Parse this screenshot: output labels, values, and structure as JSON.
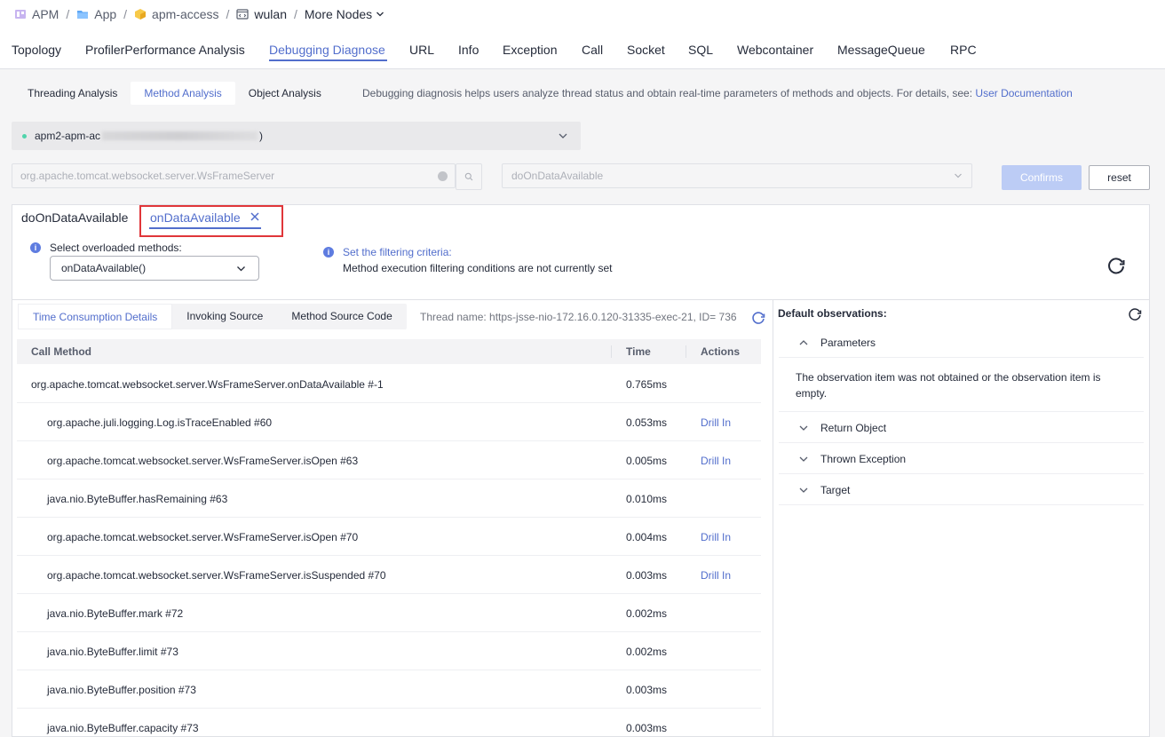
{
  "breadcrumb": {
    "items": [
      {
        "label": "APM",
        "icon": "apm-icon"
      },
      {
        "label": "App",
        "icon": "folder-icon"
      },
      {
        "label": "apm-access",
        "icon": "cube-icon"
      },
      {
        "label": "wulan",
        "icon": "code-window-icon"
      },
      {
        "label": "More Nodes",
        "icon": "chevron-down-icon"
      }
    ]
  },
  "top_tabs": [
    "Topology",
    "ProfilerPerformance Analysis",
    "Debugging Diagnose",
    "URL",
    "Info",
    "Exception",
    "Call",
    "Socket",
    "SQL",
    "Webcontainer",
    "MessageQueue",
    "RPC"
  ],
  "sub_tabs": [
    "Threading Analysis",
    "Method Analysis",
    "Object Analysis"
  ],
  "sub_desc": "Debugging diagnosis helps users analyze thread status and obtain real-time parameters of methods and objects. For details, see:",
  "sub_desc_link": "User Documentation",
  "instance": {
    "prefix": "apm2-apm-ac",
    "suffix": ")"
  },
  "class_input": {
    "value": "org.apache.tomcat.websocket.server.WsFrameServer"
  },
  "method_select": {
    "value": "doOnDataAvailable"
  },
  "buttons": {
    "confirm": "Confirms",
    "reset": "reset"
  },
  "method_tabs": [
    {
      "label": "doOnDataAvailable",
      "active": false
    },
    {
      "label": "onDataAvailable",
      "active": true
    }
  ],
  "overload": {
    "label": "Select overloaded methods:",
    "value": "onDataAvailable()"
  },
  "filter": {
    "link": "Set the filtering criteria:",
    "status": "Method execution filtering conditions are not currently set"
  },
  "inner_tabs": [
    "Time Consumption Details",
    "Invoking Source",
    "Method Source Code"
  ],
  "thread_name": "Thread name: https-jsse-nio-172.16.0.120-31335-exec-21, ID= 736",
  "table": {
    "headers": {
      "method": "Call Method",
      "time": "Time",
      "actions": "Actions"
    },
    "rows": [
      {
        "method": "org.apache.tomcat.websocket.server.WsFrameServer.onDataAvailable #-1",
        "time": "0.765ms",
        "action": "",
        "indent": 0
      },
      {
        "method": "org.apache.juli.logging.Log.isTraceEnabled #60",
        "time": "0.053ms",
        "action": "Drill In",
        "indent": 1
      },
      {
        "method": "org.apache.tomcat.websocket.server.WsFrameServer.isOpen #63",
        "time": "0.005ms",
        "action": "Drill In",
        "indent": 1
      },
      {
        "method": "java.nio.ByteBuffer.hasRemaining #63",
        "time": "0.010ms",
        "action": "",
        "indent": 1
      },
      {
        "method": "org.apache.tomcat.websocket.server.WsFrameServer.isOpen #70",
        "time": "0.004ms",
        "action": "Drill In",
        "indent": 1
      },
      {
        "method": "org.apache.tomcat.websocket.server.WsFrameServer.isSuspended #70",
        "time": "0.003ms",
        "action": "Drill In",
        "indent": 1
      },
      {
        "method": "java.nio.ByteBuffer.mark #72",
        "time": "0.002ms",
        "action": "",
        "indent": 1
      },
      {
        "method": "java.nio.ByteBuffer.limit #73",
        "time": "0.002ms",
        "action": "",
        "indent": 1
      },
      {
        "method": "java.nio.ByteBuffer.position #73",
        "time": "0.003ms",
        "action": "",
        "indent": 1
      },
      {
        "method": "java.nio.ByteBuffer.capacity #73",
        "time": "0.003ms",
        "action": "",
        "indent": 1
      }
    ]
  },
  "observations": {
    "title": "Default observations:",
    "items": [
      {
        "label": "Parameters",
        "expanded": true
      },
      {
        "label": "Return Object",
        "expanded": false
      },
      {
        "label": "Thrown Exception",
        "expanded": false
      },
      {
        "label": "Target",
        "expanded": false
      }
    ],
    "empty_text": "The observation item was not obtained or the observation item is empty."
  },
  "colors": {
    "accent": "#526ecc",
    "highlight_box": "#e0363a",
    "confirm_disabled": "#bcccf5"
  }
}
